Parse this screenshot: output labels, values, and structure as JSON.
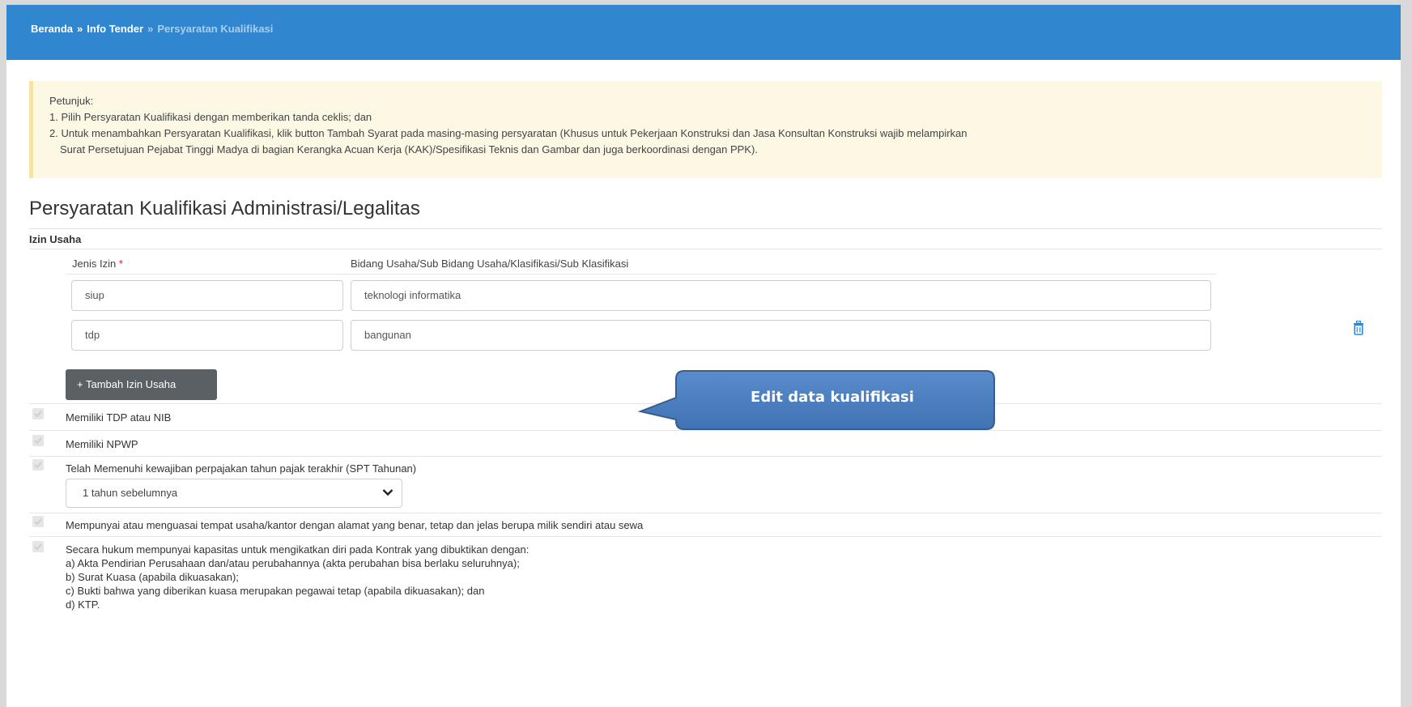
{
  "breadcrumb": {
    "home": "Beranda",
    "tender": "Info Tender",
    "current": "Persyaratan Kualifikasi",
    "separator": "»"
  },
  "hint": {
    "title": "Petunjuk:",
    "line1": "1. Pilih Persyaratan Kualifikasi dengan memberikan tanda ceklis; dan",
    "line2": "2. Untuk menambahkan Persyaratan Kualifikasi, klik button Tambah Syarat pada masing-masing persyaratan (Khusus untuk Pekerjaan Konstruksi dan Jasa Konsultan Konstruksi wajib melampirkan",
    "line3": "Surat Persetujuan Pejabat Tinggi Madya di bagian Kerangka Acuan Kerja (KAK)/Spesifikasi Teknis dan Gambar dan juga berkoordinasi dengan PPK)."
  },
  "section": {
    "heading": "Persyaratan Kualifikasi Administrasi/Legalitas",
    "izin_title": "Izin Usaha",
    "col_jenis": "Jenis Izin",
    "required_mark": "*",
    "col_bidang": "Bidang Usaha/Sub Bidang Usaha/Klasifikasi/Sub Klasifikasi",
    "rows": [
      {
        "jenis": "siup",
        "bidang": "teknologi informatika"
      },
      {
        "jenis": "tdp",
        "bidang": "bangunan"
      }
    ],
    "add_button": "+ Tambah Izin Usaha",
    "delete_icon": "trash-icon"
  },
  "requirements": {
    "r1": "Memiliki TDP atau NIB",
    "r2": "Memiliki NPWP",
    "r3": "Telah Memenuhi kewajiban perpajakan tahun pajak terakhir (SPT Tahunan)",
    "r3_select": "1 tahun sebelumnya",
    "r4": "Mempunyai atau menguasai tempat usaha/kantor dengan alamat yang benar, tetap dan jelas berupa milik sendiri atau sewa",
    "r5_lines": [
      "Secara hukum mempunyai kapasitas untuk mengikatkan diri pada Kontrak yang dibuktikan dengan:",
      "a) Akta Pendirian Perusahaan dan/atau perubahannya (akta perubahan bisa berlaku seluruhnya);",
      "b) Surat Kuasa (apabila dikuasakan);",
      "c) Bukti bahwa yang diberikan kuasa merupakan pegawai tetap (apabila dikuasakan); dan",
      "d) KTP."
    ]
  },
  "callout": {
    "text": "Edit data kualifikasi",
    "color": "#4f81bd"
  },
  "colors": {
    "header": "#3187cf",
    "hint_bg": "#fcf8e3",
    "button": "#5b6064",
    "trash": "#2a8bd8"
  }
}
